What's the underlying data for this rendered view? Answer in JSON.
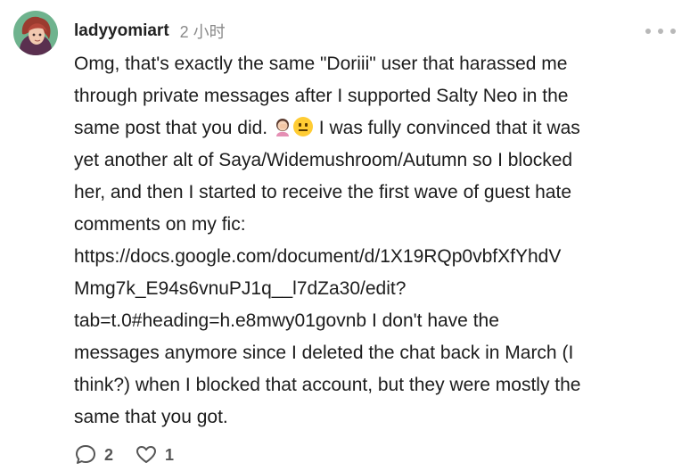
{
  "comment": {
    "username": "ladyyomiart",
    "timestamp": "2 小时",
    "body_part1": "Omg, that's exactly the same \"Doriii\" user that harassed me\nthrough private messages after I supported Salty Neo in the\nsame post that you did. ",
    "body_part2": " I was fully convinced that it was\nyet another alt of Saya/Widemushroom/Autumn so I blocked\nher, and then I started to receive the first wave of guest hate\ncomments on my fic:\n",
    "link_text": "https://docs.google.com/document/d/1X19RQp0vbfXfYhdV\nMmg7k_E94s6vnuPJ1q__l7dZa30/edit?\ntab=t.0#heading=h.e8mwy01govnb",
    "body_part3": " I don't have the\nmessages anymore since I deleted the chat back in March (I\nthink?) when I blocked that account, but they were mostly the\nsame that you got.",
    "emojis": [
      "woman-facepalming-emoji",
      "neutral-face-emoji"
    ]
  },
  "actions": {
    "reply_count": "2",
    "like_count": "1"
  },
  "icons": {
    "reply": "speech-bubble-icon",
    "like": "heart-icon",
    "more": "more-horizontal-icon"
  },
  "colors": {
    "text": "#1c1c1c",
    "muted": "#8a8a8a",
    "icon": "#555555"
  }
}
